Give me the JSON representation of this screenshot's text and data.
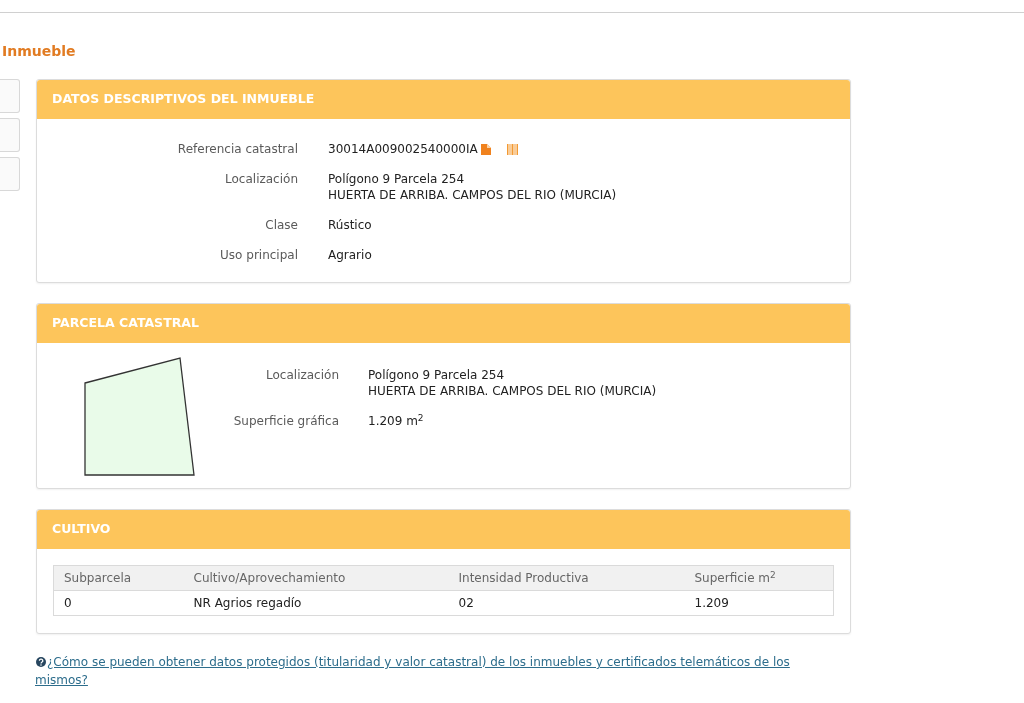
{
  "page": {
    "title": "Inmueble"
  },
  "sections": [
    {
      "kind": "fields",
      "title": "DATOS DESCRIPTIVOS DEL INMUEBLE",
      "fields": [
        {
          "kind": "reference",
          "label": "Referencia catastral",
          "lines": [
            "30014A009002540000IA"
          ]
        },
        {
          "kind": "text",
          "label": "Localización",
          "lines": [
            "Polígono 9 Parcela 254",
            "HUERTA DE ARRIBA. CAMPOS DEL RIO (MURCIA)"
          ]
        },
        {
          "kind": "text",
          "label": "Clase",
          "lines": [
            "Rústico"
          ]
        },
        {
          "kind": "text",
          "label": "Uso principal",
          "lines": [
            "Agrario"
          ]
        }
      ]
    },
    {
      "kind": "parcel",
      "title": "PARCELA CATASTRAL",
      "fields": [
        {
          "kind": "text",
          "label": "Localización",
          "lines": [
            "Polígono 9 Parcela 254",
            "HUERTA DE ARRIBA. CAMPOS DEL RIO (MURCIA)"
          ]
        },
        {
          "kind": "text",
          "label": "Superficie gráfica",
          "lines": [
            "1.209 m$^{2}$"
          ]
        }
      ]
    },
    {
      "kind": "table",
      "title": "CULTIVO",
      "columns": [
        "Subparcela",
        "Cultivo/Aprovechamiento",
        "Intensidad Productiva",
        "Superficie m$^{2}$"
      ],
      "rows": [
        [
          "0",
          "NR Agrios regadío",
          "02",
          "1.209"
        ]
      ]
    }
  ],
  "help_link": {
    "text": "¿Cómo se pueden obtener datos protegidos (titularidad y valor catastral) de los inmuebles y certificados telemáticos de los mismos?"
  }
}
